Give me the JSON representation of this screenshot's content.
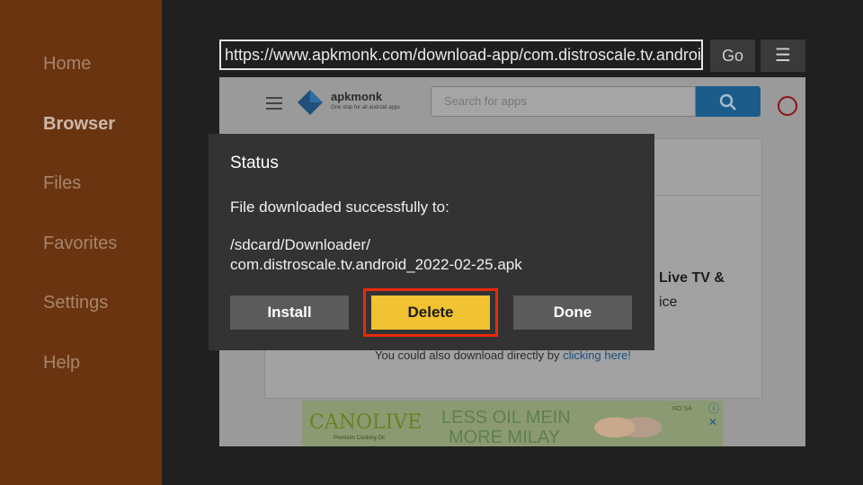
{
  "sidebar": {
    "items": [
      {
        "label": "Home",
        "active": false
      },
      {
        "label": "Browser",
        "active": true
      },
      {
        "label": "Files",
        "active": false
      },
      {
        "label": "Favorites",
        "active": false
      },
      {
        "label": "Settings",
        "active": false
      },
      {
        "label": "Help",
        "active": false
      }
    ]
  },
  "browser": {
    "url": "https://www.apkmonk.com/download-app/com.distroscale.tv.android",
    "go_label": "Go",
    "menu_icon": "hamburger-menu-icon"
  },
  "webpage": {
    "site_name": "apkmonk",
    "site_tagline": "One stop for all android apps",
    "search_placeholder": "Search for apps",
    "card_text_1": "Live TV &",
    "card_text_2": "ice",
    "download_text": "You could also download directly by",
    "download_link": "clicking here!",
    "ad": {
      "brand": "CANOLIVE",
      "sub": "Premium Cooking Oil",
      "line1": "LESS OIL MEIN",
      "line2": "MORE MILAY",
      "badge": "NO SA",
      "close": "ⓘ ✕"
    }
  },
  "dialog": {
    "title": "Status",
    "message": "File downloaded successfully to:",
    "path_line1": "/sdcard/Downloader/",
    "path_line2": "com.distroscale.tv.android_2022-02-25.apk",
    "install_label": "Install",
    "delete_label": "Delete",
    "done_label": "Done"
  },
  "colors": {
    "sidebar_bg": "#6b3410",
    "delete_button": "#f1c232",
    "highlight_outline": "#e82a0c",
    "dialog_bg": "#333333"
  }
}
